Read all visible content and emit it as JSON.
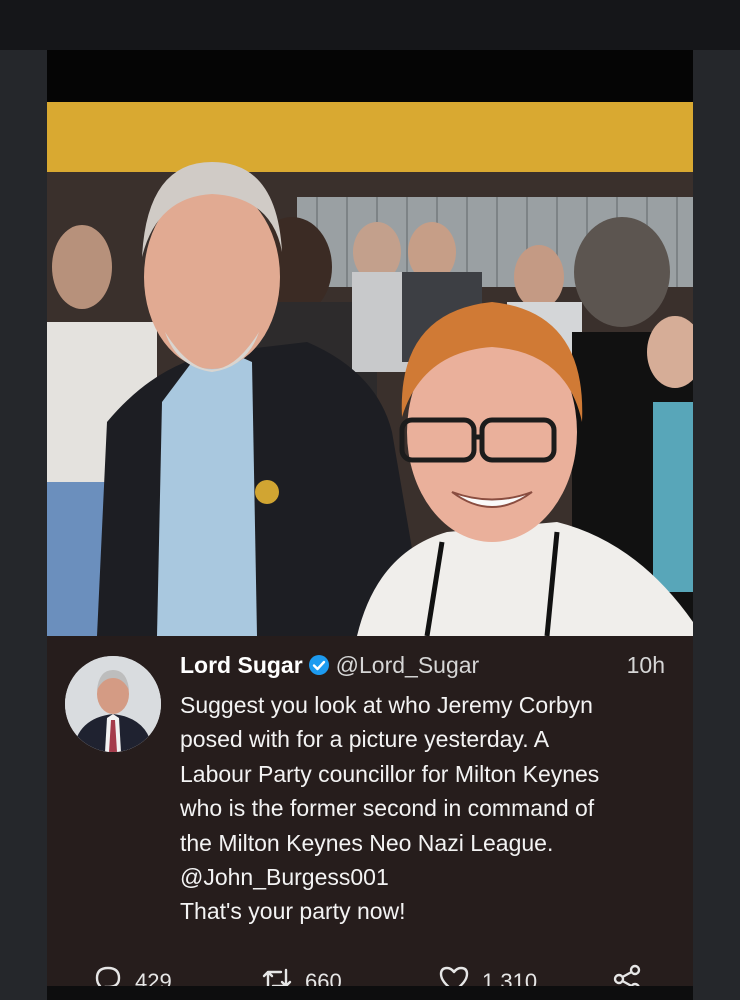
{
  "tweet": {
    "display_name": "Lord Sugar",
    "handle": "@Lord_Sugar",
    "time": "10h",
    "lines": [
      "Suggest you look at who Jeremy Corbyn",
      "posed with for a picture yesterday. A",
      "Labour Party councillor for Milton Keynes",
      "who is the former second in command of",
      "the Milton Keynes Neo Nazi League.",
      "@John_Burgess001",
      "That's your party now!"
    ]
  },
  "actions": {
    "replies": "429",
    "retweets": "660",
    "likes": "1,310"
  },
  "icons": {
    "verified": "verified-badge-icon",
    "reply": "reply-icon",
    "retweet": "retweet-icon",
    "like": "heart-icon",
    "share": "share-icon"
  },
  "colors": {
    "card_background": "#261d1c",
    "verified_blue": "#1d9bf0",
    "text": "#f3f3f3"
  }
}
